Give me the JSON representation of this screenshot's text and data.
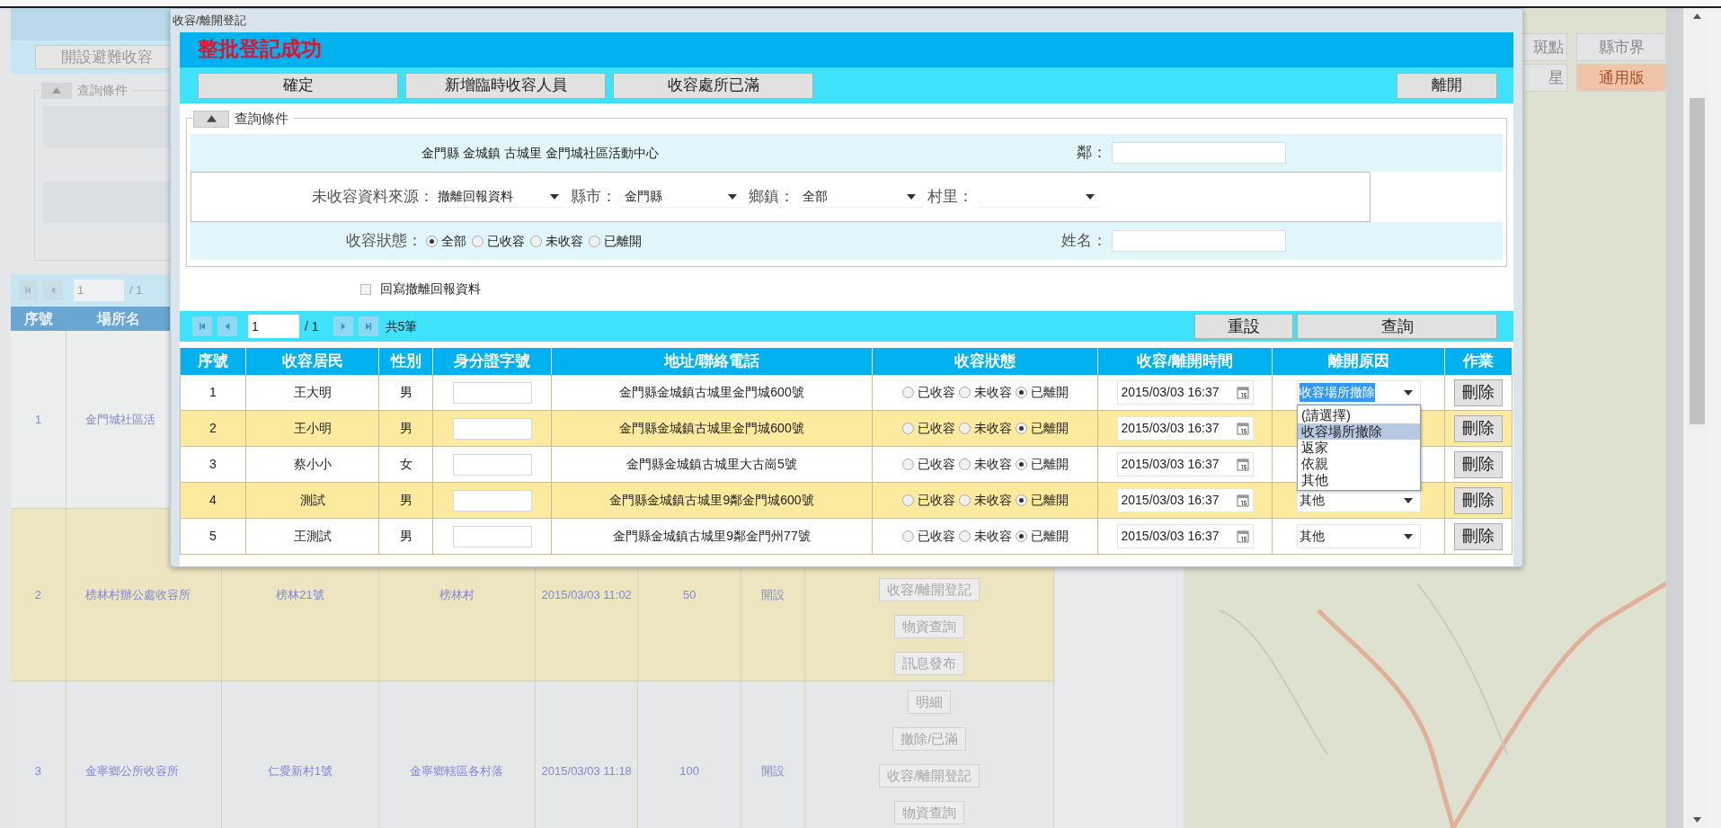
{
  "page": {
    "open_button": "開設避難收容",
    "filter_legend": "查詢條件",
    "pager": {
      "page": "1",
      "total": "/ 1"
    },
    "columns": [
      "序號",
      "場所名"
    ],
    "rows": [
      {
        "cells": [
          "1",
          "金門城社區活"
        ],
        "actions": []
      },
      {
        "cells": [
          "2",
          "榜林村辦公處收容所",
          "榜林21號",
          "榜林村",
          "2015/03/03 11:02",
          "50",
          "開設"
        ],
        "actions": [
          "收容/離開登記",
          "物資查詢",
          "訊息發布"
        ]
      },
      {
        "cells": [
          "3",
          "金寧鄉公所收容所",
          "仁愛新村1號",
          "金寧鄉轄區各村落",
          "2015/03/03 11:18",
          "100",
          "開設"
        ],
        "actions": [
          "明細",
          "撤除/已滿",
          "收容/離開登記",
          "物資查詢"
        ]
      }
    ]
  },
  "map": {
    "buttons": [
      {
        "label": "斑點",
        "selected": false
      },
      {
        "label": "縣市界",
        "selected": false
      },
      {
        "label": "星",
        "selected": false
      },
      {
        "label": "通用版",
        "selected": true
      }
    ]
  },
  "dialog": {
    "title": "收容/離開登記",
    "banner": "整批登記成功",
    "actions": [
      "確定",
      "新增臨時收容人員",
      "收容處所已滿"
    ],
    "close_button": "離開",
    "filter": {
      "legend": "查詢條件",
      "location": "金門縣 金城鎮 古城里 金門城社區活動中心",
      "neighborhood_label": "鄰：",
      "source_label": "未收容資料來源：",
      "source": "撤離回報資料",
      "county_label": "縣市：",
      "county": "金門縣",
      "town_label": "鄉鎮：",
      "town": "全部",
      "village_label": "村里：",
      "status_label": "收容狀態：",
      "status_options": [
        {
          "label": "全部",
          "selected": true
        },
        {
          "label": "已收容",
          "selected": false
        },
        {
          "label": "未收容",
          "selected": false
        },
        {
          "label": "已離開",
          "selected": false
        }
      ],
      "name_label": "姓名："
    },
    "writeback": {
      "label": "回寫撤離回報資料",
      "checked": false
    },
    "pager": {
      "page": "1",
      "total": "/ 1",
      "count": "共5筆"
    },
    "reset_button": "重設",
    "query_button": "查詢",
    "columns": [
      "序號",
      "收容居民",
      "性別",
      "身分證字號",
      "地址/聯絡電話",
      "收容狀態",
      "收容/離開時間",
      "離開原因",
      "作業"
    ],
    "rows": [
      {
        "index": "1",
        "name": "王大明",
        "gender": "男",
        "address": "金門縣金城鎮古城里金門城600號",
        "status": [
          {
            "label": "已收容",
            "selected": false
          },
          {
            "label": "未收容",
            "selected": false
          },
          {
            "label": "已離開",
            "selected": true
          }
        ],
        "time": "2015/03/03 16:37",
        "reason": {
          "value": "收容場所撤除",
          "highlighted": true,
          "options": [
            {
              "label": "(請選擇)",
              "selected": false
            },
            {
              "label": "收容場所撤除",
              "selected": true
            },
            {
              "label": "返家",
              "selected": false
            },
            {
              "label": "依親",
              "selected": false
            },
            {
              "label": "其他",
              "selected": false
            }
          ]
        },
        "delete": "刪除"
      },
      {
        "index": "2",
        "name": "王小明",
        "gender": "男",
        "address": "金門縣金城鎮古城里金門城600號",
        "status": [
          {
            "label": "已收容",
            "selected": false
          },
          {
            "label": "未收容",
            "selected": false
          },
          {
            "label": "已離開",
            "selected": true
          }
        ],
        "time": "2015/03/03 16:37",
        "delete": "刪除"
      },
      {
        "index": "3",
        "name": "蔡小小",
        "gender": "女",
        "address": "金門縣金城鎮古城里大古崗5號",
        "status": [
          {
            "label": "已收容",
            "selected": false
          },
          {
            "label": "未收容",
            "selected": false
          },
          {
            "label": "已離開",
            "selected": true
          }
        ],
        "time": "2015/03/03 16:37",
        "delete": "刪除"
      },
      {
        "index": "4",
        "name": "測試",
        "gender": "男",
        "address": "金門縣金城鎮古城里9鄰金門城600號",
        "status": [
          {
            "label": "已收容",
            "selected": false
          },
          {
            "label": "未收容",
            "selected": false
          },
          {
            "label": "已離開",
            "selected": true
          }
        ],
        "time": "2015/03/03 16:37",
        "reason": {
          "value": "其他",
          "highlighted": false
        },
        "delete": "刪除"
      },
      {
        "index": "5",
        "name": "王測試",
        "gender": "男",
        "address": "金門縣金城鎮古城里9鄰金門州77號",
        "status": [
          {
            "label": "已收容",
            "selected": false
          },
          {
            "label": "未收容",
            "selected": false
          },
          {
            "label": "已離開",
            "selected": true
          }
        ],
        "time": "2015/03/03 16:37",
        "reason": {
          "value": "其他",
          "highlighted": false
        },
        "delete": "刪除"
      }
    ]
  }
}
